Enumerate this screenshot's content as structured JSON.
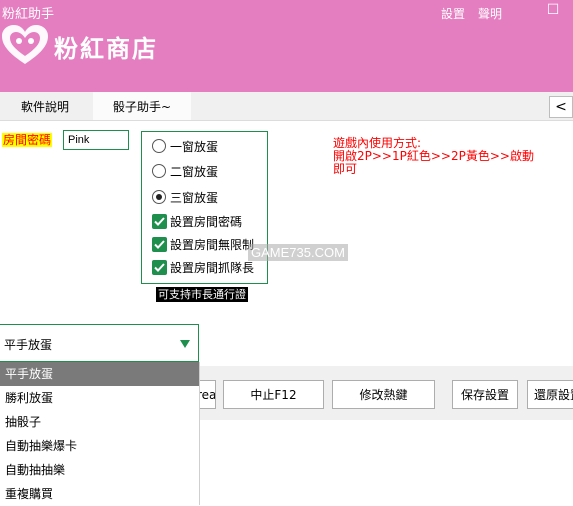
{
  "window": {
    "title": "粉紅助手",
    "settings_link": "設置",
    "about_link": "聲明",
    "close_glyph": "☐"
  },
  "brand": {
    "name": "粉紅商店"
  },
  "tabs": [
    {
      "label": "軟件說明"
    },
    {
      "label": "骰子助手~"
    }
  ],
  "tab_scroll_glyph": "<",
  "room": {
    "label": "房間密碼",
    "value": "Pink"
  },
  "options": {
    "radios": [
      {
        "label": "一窗放蛋",
        "selected": false
      },
      {
        "label": "二窗放蛋",
        "selected": false
      },
      {
        "label": "三窗放蛋",
        "selected": true
      }
    ],
    "checkboxes": [
      {
        "label": "設置房間密碼",
        "checked": true
      },
      {
        "label": "設置房間無限制",
        "checked": true
      },
      {
        "label": "設置房間抓隊長",
        "checked": true
      }
    ]
  },
  "note_badge": "可支持市長通行證",
  "watermark": "GAME735.COM",
  "instructions": {
    "line1": "遊戲內使用方式:",
    "line2": "開啟2P>>1P紅色>>2P黃色>>啟動",
    "line3": "即可"
  },
  "buttons": {
    "start_partial": "rea",
    "stop": "中止F12",
    "hotkey": "修改熱鍵",
    "save": "保存設置",
    "restore": "還原設置"
  },
  "dropdown": {
    "selected": "平手放蛋",
    "items": [
      "平手放蛋",
      "勝利放蛋",
      "抽骰子",
      "自動抽樂爆卡",
      "自動抽抽樂",
      "重複購買"
    ]
  },
  "colors": {
    "header": "#e47ec0",
    "accent_green": "#1f8f4e",
    "instruction_red": "#ff0000"
  }
}
